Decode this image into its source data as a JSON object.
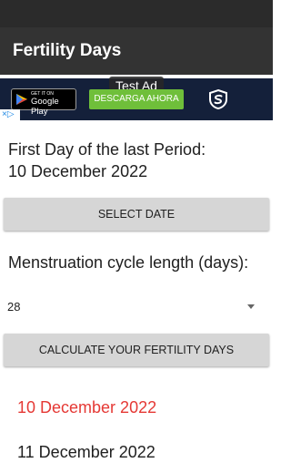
{
  "app": {
    "title": "Fertility Days"
  },
  "ad": {
    "test_label": "Test Ad",
    "store_small": "GET IT ON",
    "store_big": "Google Play",
    "cta": "DESCARGA AHORA",
    "logo_icon": "s-shield-logo-icon",
    "choices_icon": "adchoices-icon"
  },
  "form": {
    "first_day_label": "First Day of the last Period:",
    "first_day_value": "10 December 2022",
    "select_date_button": "SELECT DATE",
    "cycle_label": "Menstruation cycle length (days):",
    "cycle_value": "28",
    "calculate_button": "CALCULATE YOUR FERTILITY DAYS"
  },
  "results": [
    {
      "date": "10 December 2022",
      "color": "#e53935"
    },
    {
      "date": "11 December 2022",
      "color": "#202020"
    }
  ]
}
